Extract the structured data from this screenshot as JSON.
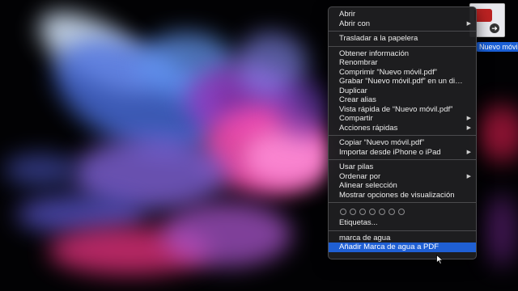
{
  "desktop_file": {
    "name": "Nuevo móvil.pdf"
  },
  "context_menu": {
    "groups": [
      [
        {
          "label": "Abrir"
        },
        {
          "label": "Abrir con",
          "submenu": true
        }
      ],
      [
        {
          "label": "Trasladar a la papelera"
        }
      ],
      [
        {
          "label": "Obtener información"
        },
        {
          "label": "Renombrar"
        },
        {
          "label": "Comprimir “Nuevo móvil.pdf”"
        },
        {
          "label": "Grabar “Nuevo móvil.pdf” en un disco..."
        },
        {
          "label": "Duplicar"
        },
        {
          "label": "Crear alias"
        },
        {
          "label": "Vista rápida de “Nuevo móvil.pdf”"
        },
        {
          "label": "Compartir",
          "submenu": true
        },
        {
          "label": "Acciones rápidas",
          "submenu": true
        }
      ],
      [
        {
          "label": "Copiar “Nuevo móvil.pdf”"
        },
        {
          "label": "Importar desde iPhone o iPad",
          "submenu": true
        }
      ],
      [
        {
          "label": "Usar pilas"
        },
        {
          "label": "Ordenar por",
          "submenu": true
        },
        {
          "label": "Alinear selección"
        },
        {
          "label": "Mostrar opciones de visualización"
        }
      ]
    ],
    "tags_label": "Etiquetas...",
    "services": [
      {
        "label": "marca de agua"
      },
      {
        "label": "Añadir Marca de agua a PDF",
        "highlighted": true
      }
    ],
    "tag_count": 7
  },
  "colors": {
    "highlight": "#1f5fd3",
    "menu_bg": "#1e1e20"
  }
}
